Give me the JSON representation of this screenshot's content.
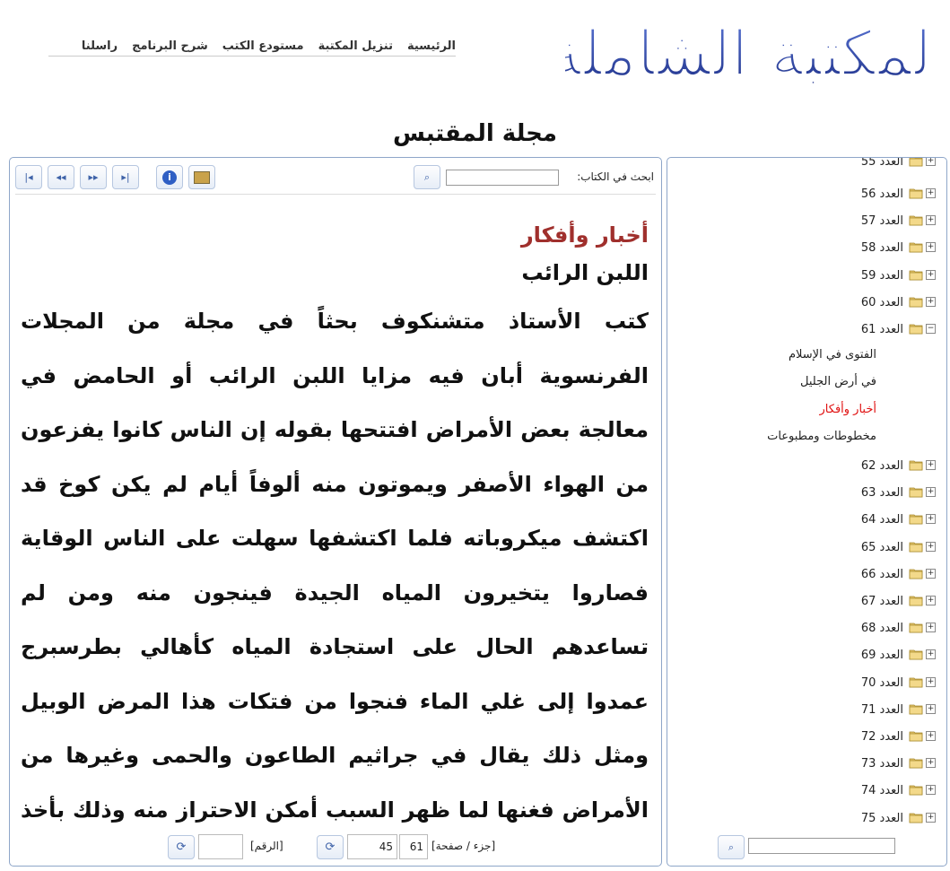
{
  "logo_text": "المكتبة الشاملة",
  "nav": [
    "الرئيسية",
    "تنزيل المكتبة",
    "مستودع الكتب",
    "شرح البرنامج",
    "راسلنا"
  ],
  "book_title": "مجلة المقتبس",
  "toolbar": {
    "search_label": "ابحث في الكتاب:",
    "search_value": "",
    "icons": [
      "first-page-icon",
      "prev-page-icon",
      "next-page-icon",
      "last-page-icon",
      "info-icon",
      "print-icon"
    ]
  },
  "content": {
    "section_title": "أخبار وأفكار",
    "article_title": "اللبن الرائب",
    "body": "كتب الأستاذ متشنكوف بحثاً في مجلة من المجلات الفرنسوية أبان فيه مزايا اللبن الرائب أو الحامض في معالجة بعض الأمراض افتتحها بقوله إن الناس كانوا يفزعون من الهواء الأصفر ويموتون منه ألوفاً أيام لم يكن كوخ قد اكتشف ميكروباته فلما اكتشفها سهلت على الناس الوقاية فصاروا يتخيرون المياه الجيدة فينجون منه ومن لم تساعدهم الحال على استجادة المياه كأهالي بطرسبرج عمدوا إلى غلي الماء فنجوا من فتكات هذا المرض الوبيل ومثل ذلك يقال في جراثيم الطاعون والحمى وغيرها من الأمراض فغنها لما ظهر السبب أمكن الاحتراز منه وذلك بأخذ الاحتياط اللازم"
  },
  "pager": {
    "part_page_label": "[جزء / صفحة]",
    "part": "61",
    "page": "45",
    "number_label": "[الرقم]",
    "number_value": ""
  },
  "tree": {
    "prefix": "العدد",
    "top_items": [
      {
        "label": "العدد 55",
        "expanded": false
      },
      {
        "label": "العدد 56",
        "expanded": false
      },
      {
        "label": "العدد 57",
        "expanded": false
      },
      {
        "label": "العدد 58",
        "expanded": false
      },
      {
        "label": "العدد 59",
        "expanded": false
      },
      {
        "label": "العدد 60",
        "expanded": false
      },
      {
        "label": "العدد 61",
        "expanded": true
      }
    ],
    "sub_items": [
      "الفتوى في الإسلام",
      "في أرض الجليل",
      "أخبار وأفكار",
      "مخطوطات ومطبوعات"
    ],
    "active_sub": "أخبار وأفكار",
    "bottom_items": [
      "العدد 62",
      "العدد 63",
      "العدد 64",
      "العدد 65",
      "العدد 66",
      "العدد 67",
      "العدد 68",
      "العدد 69",
      "العدد 70",
      "العدد 71",
      "العدد 72",
      "العدد 73",
      "العدد 74",
      "العدد 75"
    ],
    "search_value": ""
  },
  "colors": {
    "logo_blue": "#2a3f9a",
    "section_title": "#a0302d",
    "active_tree_item": "#e01010",
    "panel_border": "#8ea6c9"
  }
}
